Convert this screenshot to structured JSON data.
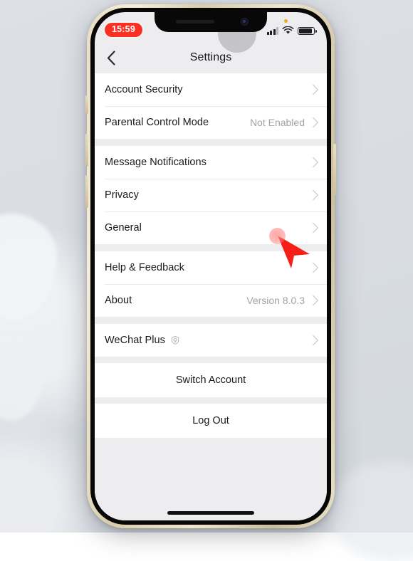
{
  "device": {
    "status_bar": {
      "time": "15:59",
      "signal_icon": "cellular-signal-icon",
      "wifi_icon": "wifi-icon",
      "battery_icon": "battery-icon",
      "recording_indicator": "orange-dot-icon"
    },
    "home_indicator": "home-indicator"
  },
  "nav": {
    "back_icon": "back-chevron-icon",
    "title": "Settings",
    "touch_indicator": "touch-circle-indicator"
  },
  "sections": [
    {
      "rows": [
        {
          "label": "Account Security",
          "value": "",
          "icon": "",
          "chevron": "chevron-right-icon"
        },
        {
          "label": "Parental Control Mode",
          "value": "Not Enabled",
          "icon": "",
          "chevron": "chevron-right-icon"
        }
      ]
    },
    {
      "rows": [
        {
          "label": "Message Notifications",
          "value": "",
          "icon": "",
          "chevron": "chevron-right-icon"
        },
        {
          "label": "Privacy",
          "value": "",
          "icon": "",
          "chevron": "chevron-right-icon"
        },
        {
          "label": "General",
          "value": "",
          "icon": "",
          "chevron": "chevron-right-icon"
        }
      ]
    },
    {
      "rows": [
        {
          "label": "Help & Feedback",
          "value": "",
          "icon": "",
          "chevron": "chevron-right-icon"
        },
        {
          "label": "About",
          "value": "Version 8.0.3",
          "icon": "",
          "chevron": "chevron-right-icon"
        }
      ]
    },
    {
      "rows": [
        {
          "label": "WeChat Plus",
          "value": "",
          "icon": "plus-badge-icon",
          "chevron": "chevron-right-icon"
        }
      ]
    }
  ],
  "actions": [
    {
      "label": "Switch Account"
    },
    {
      "label": "Log Out"
    }
  ],
  "cursor": {
    "icon": "red-arrow-cursor-icon",
    "tap_indicator": "tap-highlight-dot",
    "target_row": "General"
  },
  "colors": {
    "accent_red": "#fc2f23",
    "cursor_red": "#f51f18",
    "screen_bg": "#ededf0",
    "card_bg": "#ffffff",
    "primary_text": "#191919",
    "secondary_text": "#a2a2a8"
  }
}
